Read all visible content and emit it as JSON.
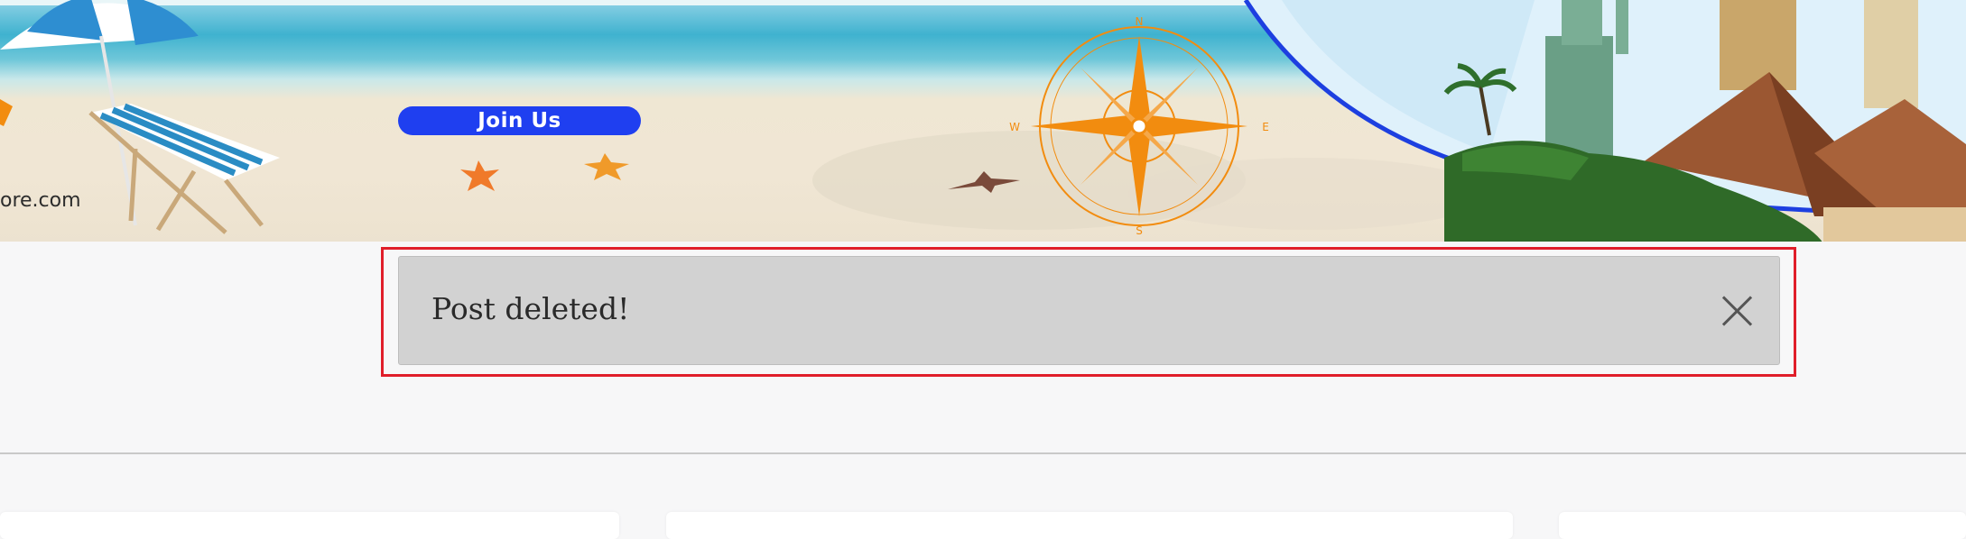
{
  "banner": {
    "join_label": "Join Us",
    "site_text": "ore.com",
    "compass": {
      "n": "N",
      "e": "E",
      "s": "S",
      "w": "W"
    }
  },
  "alert": {
    "message": "Post deleted!",
    "close_icon": "close-icon"
  },
  "colors": {
    "join_button": "#1f3ff0",
    "alert_background": "#d2d2d2",
    "highlight_border": "#e01e2a",
    "compass": "#f28c0f"
  }
}
